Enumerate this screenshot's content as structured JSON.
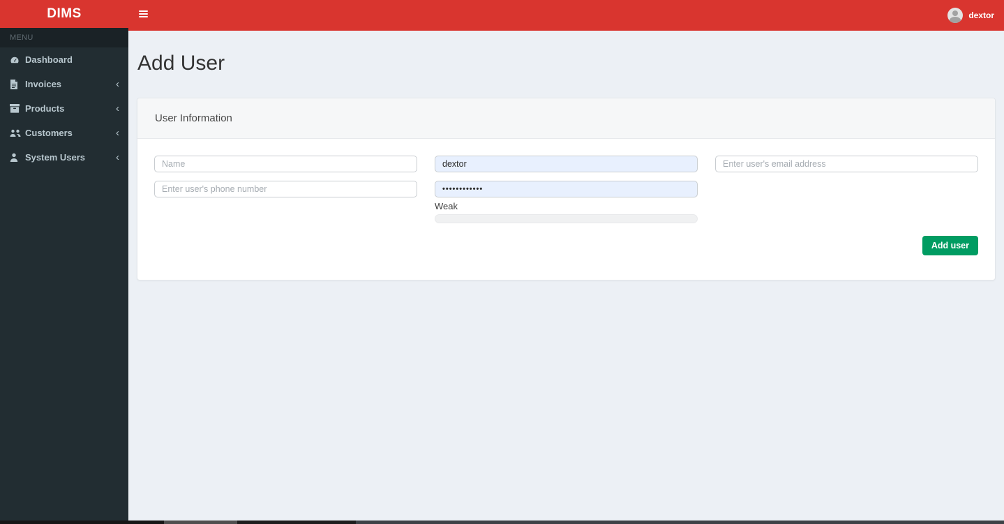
{
  "topbar": {
    "brand": "DIMS",
    "user": {
      "name": "dextor"
    }
  },
  "sidebar": {
    "menu_header": "MENU",
    "items": [
      {
        "label": "Dashboard",
        "icon": "dashboard-icon",
        "has_submenu": false
      },
      {
        "label": "Invoices",
        "icon": "invoices-icon",
        "has_submenu": true
      },
      {
        "label": "Products",
        "icon": "products-icon",
        "has_submenu": true
      },
      {
        "label": "Customers",
        "icon": "customers-icon",
        "has_submenu": true
      },
      {
        "label": "System Users",
        "icon": "system-users-icon",
        "has_submenu": true
      }
    ],
    "chevron_glyph": "‹"
  },
  "main": {
    "page_title": "Add User",
    "card": {
      "header": "User Information",
      "fields": {
        "name_placeholder": "Name",
        "phone_placeholder": "Enter user's phone number",
        "username_value": "dextor",
        "password_masked": "••••••••••••",
        "password_strength_label": "Weak",
        "email_placeholder": "Enter user's email address"
      },
      "submit_label": "Add user"
    }
  },
  "colors": {
    "topbar_red": "#d9352f",
    "sidebar_dark": "#222d32",
    "sidebar_header_dark": "#1a2226",
    "content_bg": "#ecf0f5",
    "button_green": "#009c62",
    "autofill_blue": "#e8f0fe",
    "sidebar_text": "#b8c7ce"
  }
}
